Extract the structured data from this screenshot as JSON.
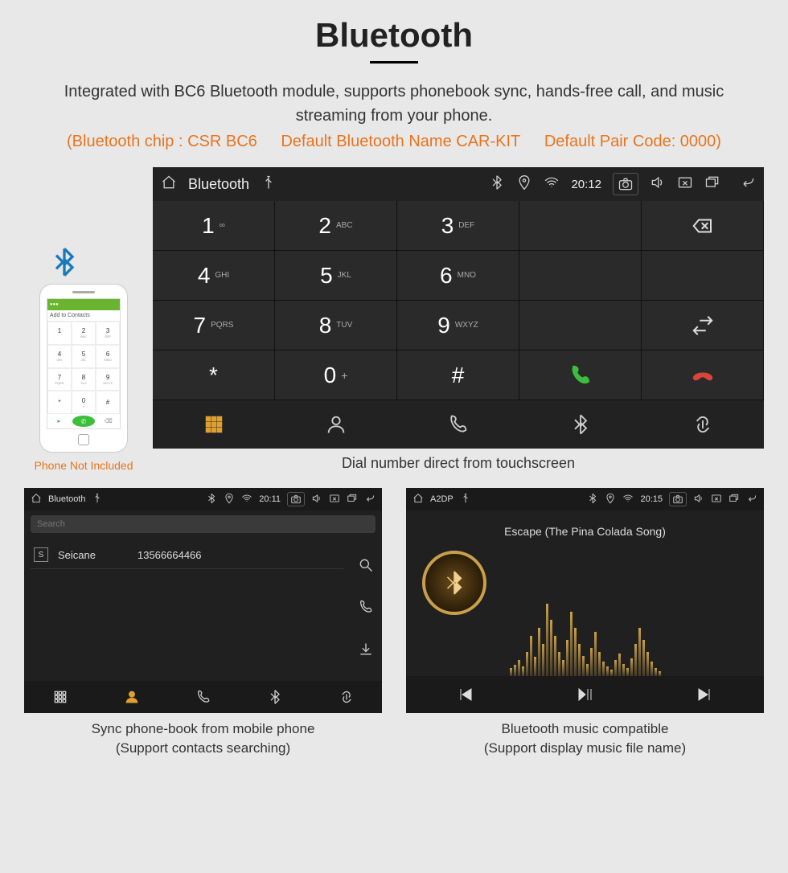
{
  "page": {
    "title": "Bluetooth",
    "subtitle": "Integrated with BC6 Bluetooth module, supports phonebook sync, hands-free call, and music streaming from your phone.",
    "spec_chip": "(Bluetooth chip : CSR BC6",
    "spec_name": "Default Bluetooth Name CAR-KIT",
    "spec_pair": "Default Pair Code: 0000)"
  },
  "phone": {
    "add_label": "Add to Contacts",
    "caption": "Phone Not Included"
  },
  "dialer": {
    "statusbar": {
      "title": "Bluetooth",
      "time": "20:12"
    },
    "keys": [
      {
        "d": "1",
        "l": "∞"
      },
      {
        "d": "2",
        "l": "ABC"
      },
      {
        "d": "3",
        "l": "DEF"
      },
      {
        "d": "4",
        "l": "GHI"
      },
      {
        "d": "5",
        "l": "JKL"
      },
      {
        "d": "6",
        "l": "MNO"
      },
      {
        "d": "7",
        "l": "PQRS"
      },
      {
        "d": "8",
        "l": "TUV"
      },
      {
        "d": "9",
        "l": "WXYZ"
      },
      {
        "d": "*",
        "l": ""
      },
      {
        "d": "0",
        "l": "+",
        "sup": true
      },
      {
        "d": "#",
        "l": ""
      }
    ],
    "caption": "Dial number direct from touchscreen"
  },
  "phonebook": {
    "statusbar": {
      "title": "Bluetooth",
      "time": "20:11"
    },
    "search_placeholder": "Search",
    "contact": {
      "letter": "S",
      "name": "Seicane",
      "number": "13566664466"
    },
    "caption1": "Sync phone-book from mobile phone",
    "caption2": "(Support contacts searching)"
  },
  "music": {
    "statusbar": {
      "title": "A2DP",
      "time": "20:15"
    },
    "song": "Escape (The Pina Colada Song)",
    "caption1": "Bluetooth music compatible",
    "caption2": "(Support display music file name)"
  }
}
